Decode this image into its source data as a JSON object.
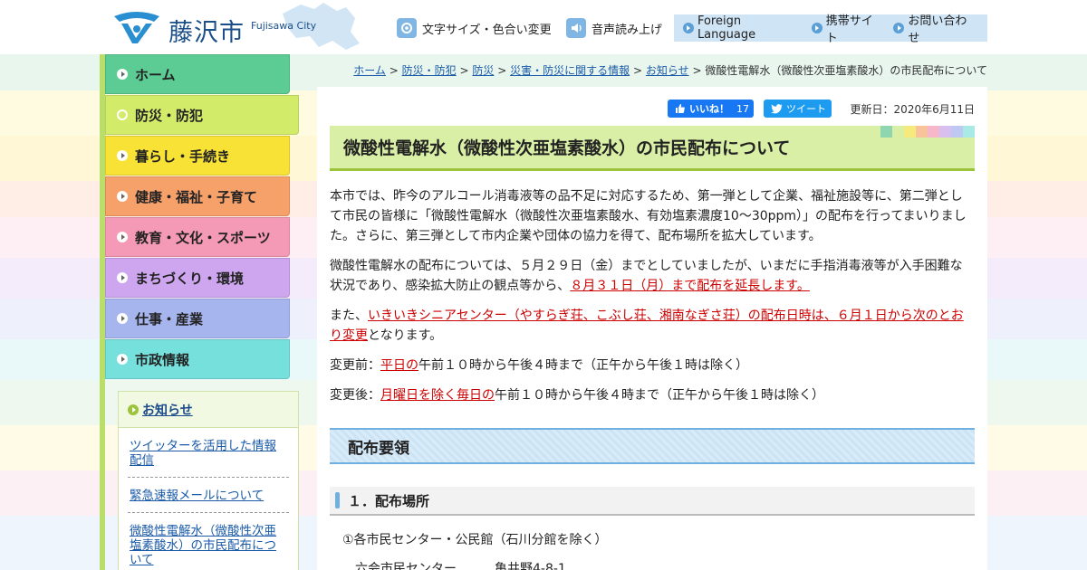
{
  "header": {
    "logo_text": "藤沢市",
    "logo_sub": "Fujisawa City",
    "util_text_size": "文字サイズ・色合い変更",
    "util_voice": "音声読み上げ",
    "foreign_language": "Foreign Language",
    "mobile_site": "携帯サイト",
    "contact": "お問い合わせ"
  },
  "nav": {
    "items": [
      {
        "label": "ホーム",
        "color": "#5ccc94"
      },
      {
        "label": "防災・防犯",
        "color": "#d2ec6a"
      },
      {
        "label": "暮らし・手続き",
        "color": "#f7e235"
      },
      {
        "label": "健康・福祉・子育て",
        "color": "#f6a06a"
      },
      {
        "label": "教育・文化・スポーツ",
        "color": "#f59ab6"
      },
      {
        "label": "まちづくり・環境",
        "color": "#cda6ef"
      },
      {
        "label": "仕事・産業",
        "color": "#a7b5ef"
      },
      {
        "label": "市政情報",
        "color": "#76e0dc"
      }
    ]
  },
  "side_news": {
    "title": "お知らせ",
    "items": [
      "ツイッターを活用した情報配信",
      "緊急速報メールについて",
      "微酸性電解水（微酸性次亜塩素酸水）の市民配布について"
    ]
  },
  "breadcrumb": {
    "links": [
      "ホーム",
      "防災・防犯",
      "防災",
      "災害・防災に関する情報",
      "お知らせ"
    ],
    "separator": ">",
    "current": "微酸性電解水（微酸性次亜塩素酸水）の市民配布について"
  },
  "share": {
    "like_label": "いいね！",
    "like_count": "17",
    "tweet_label": "ツイート",
    "updated": "更新日：2020年6月11日"
  },
  "article": {
    "title": "微酸性電解水（微酸性次亜塩素酸水）の市民配布について",
    "p1": "本市では、昨今のアルコール消毒液等の品不足に対応するため、第一弾として企業、福祉施設等に、第二弾として市民の皆様に「微酸性電解水（微酸性次亜塩素酸水、有効塩素濃度10～30ppm）」の配布を行ってまいりました。さらに、第三弾として市内企業や団体の協力を得て、配布場所を拡大しています。",
    "p2_a": "微酸性電解水の配布については、５月２９日（金）までとしていましたが、いまだに手指消毒液等が入手困難な状況であり、感染拡大防止の観点等から、",
    "p2_hl": "８月３１日（月）まで配布を延長します。",
    "p3_a": "また、",
    "p3_hl": "いきいきシニアセンター（やすらぎ荘、こぶし荘、湘南なぎさ荘）の配布日時は、６月１日から次のとおり変更",
    "p3_b": "となります。",
    "p4_a": "変更前：",
    "p4_hl": "平日の",
    "p4_b": "午前１０時から午後４時まで（正午から午後１時は除く）",
    "p5_a": "変更後：",
    "p5_hl": "月曜日を除く毎日の",
    "p5_b": "午前１０時から午後４時まで（正午から午後１時は除く）",
    "h2": "配布要領",
    "h3": "１．配布場所",
    "loc1": "①各市民センター・公民館（石川分館を除く）",
    "loc_row_name": "六会市民センター",
    "loc_row_addr": "亀井野4-8-1"
  },
  "colors": {
    "brand_blue": "#1b4f8a",
    "title_bg": "#d9efa5",
    "highlight_red": "#cc0000",
    "link_blue": "#1a5aa8"
  }
}
